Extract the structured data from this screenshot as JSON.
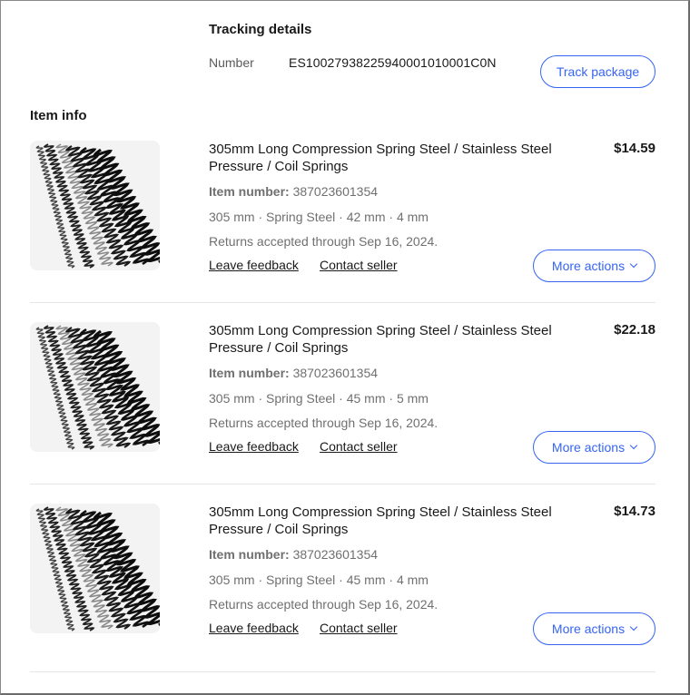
{
  "tracking": {
    "title": "Tracking details",
    "number_label": "Number",
    "number_value": "ES10027938225940001010001C0N",
    "track_button": "Track package"
  },
  "item_info": {
    "title": "Item info",
    "items": [
      {
        "title": "305mm Long Compression Spring Steel / Stainless Steel Pressure / Coil Springs",
        "price": "$14.59",
        "item_number_label": "Item number:",
        "item_number": "387023601354",
        "specs": "305 mm · Spring Steel · 42 mm · 4 mm",
        "returns": "Returns accepted through Sep 16, 2024.",
        "leave_feedback": "Leave feedback",
        "contact_seller": "Contact seller",
        "more_actions": "More actions",
        "image_icon": "coil-springs-product-image"
      },
      {
        "title": "305mm Long Compression Spring Steel / Stainless Steel Pressure / Coil Springs",
        "price": "$22.18",
        "item_number_label": "Item number:",
        "item_number": "387023601354",
        "specs": "305 mm · Spring Steel · 45 mm · 5 mm",
        "returns": "Returns accepted through Sep 16, 2024.",
        "leave_feedback": "Leave feedback",
        "contact_seller": "Contact seller",
        "more_actions": "More actions",
        "image_icon": "coil-springs-product-image"
      },
      {
        "title": "305mm Long Compression Spring Steel / Stainless Steel Pressure / Coil Springs",
        "price": "$14.73",
        "item_number_label": "Item number:",
        "item_number": "387023601354",
        "specs": "305 mm · Spring Steel · 45 mm · 4 mm",
        "returns": "Returns accepted through Sep 16, 2024.",
        "leave_feedback": "Leave feedback",
        "contact_seller": "Contact seller",
        "more_actions": "More actions",
        "image_icon": "coil-springs-product-image"
      }
    ]
  },
  "colors": {
    "accent": "#3665f3",
    "text": "#191919",
    "muted": "#707070",
    "divider": "#e5e5e5"
  }
}
